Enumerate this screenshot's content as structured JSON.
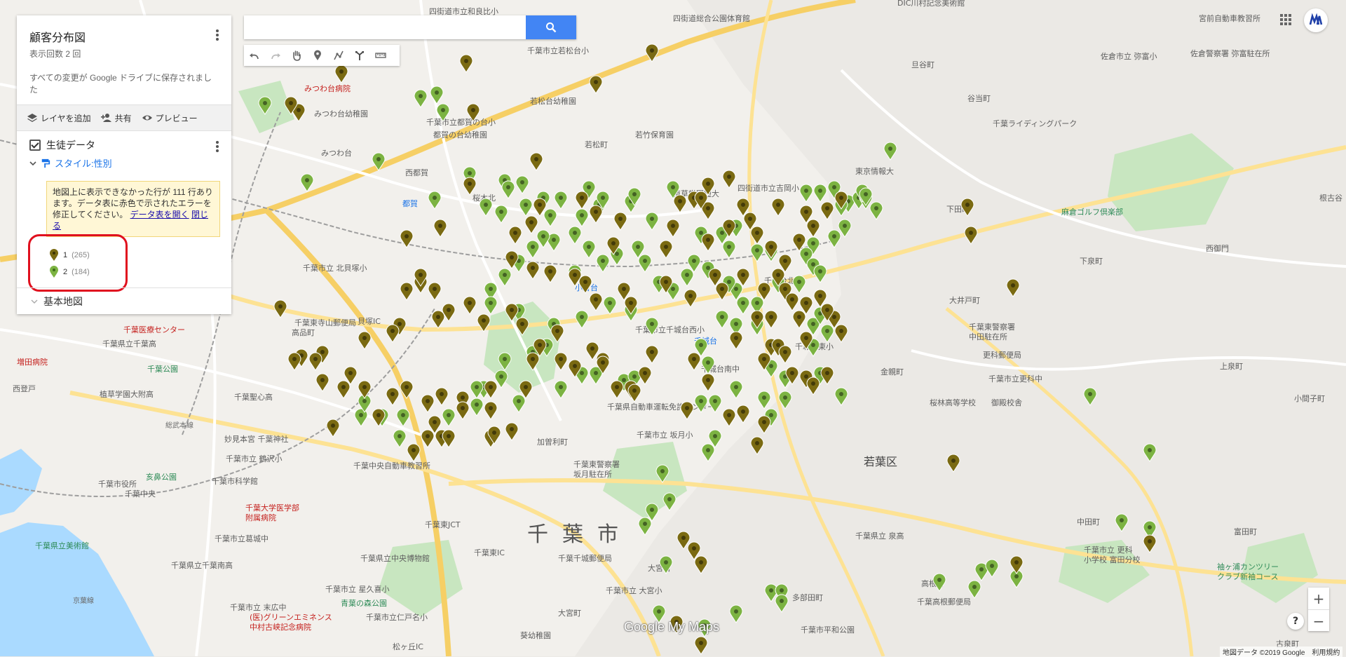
{
  "panel": {
    "title": "顧客分布図",
    "view_count": "表示回数 2 回",
    "save_status": "すべての変更が Google ドライブに保存されました",
    "toolbar": {
      "add_layer": "レイヤを追加",
      "share": "共有",
      "preview": "プレビュー"
    },
    "layer": {
      "name": "生徒データ",
      "style_label": "スタイル:性別",
      "error": {
        "message": "地図上に表示できなかった行が 111 行あります。データ表に赤色で示されたエラーを修正してください。",
        "open_link": "データ表を開く",
        "close_link": "閉じる"
      },
      "legend": [
        {
          "label": "1",
          "count": "(265)",
          "color": "#7a6a12"
        },
        {
          "label": "2",
          "count": "(184)",
          "color": "#7cb342"
        }
      ]
    },
    "base_map_label": "基本地図"
  },
  "search": {
    "placeholder": ""
  },
  "zoom": {
    "in": "+",
    "out": "−"
  },
  "help": "?",
  "logo": "Google My Maps",
  "attribution": "地図データ ©2019 Google　利用規約",
  "map": {
    "city": "千葉市",
    "ward": "若葉区",
    "labels": [
      "四街道市立和良比小",
      "四街道総合公園体育館",
      "DIC川村記念美術館",
      "宮前自動車教習所",
      "佐倉市立 弥富小",
      "佐倉警察署 弥富駐在所",
      "旦谷町",
      "谷当町",
      "千葉ライディングパーク",
      "千葉市立若松台小",
      "若松台幼稚園",
      "若松町",
      "若竹保育園",
      "みつわ台病院",
      "みつわ台幼稚園",
      "千葉市立都賀の台小",
      "都賀の台幼稚園",
      "西都賀",
      "みつわ台",
      "千葉市立桜木小",
      "都賀",
      "東京情報大",
      "下田町",
      "麻倉ゴルフ倶楽部",
      "根古谷",
      "四街道市立吉岡小",
      "植草学園短大",
      "西御門",
      "下泉町",
      "大井戸町",
      "千葉東警察署 中田駐在所",
      "更科郵便局",
      "千葉市立更科中",
      "千葉市立北貝塚小",
      "千葉東寺山郵便局",
      "高品町",
      "千葉医療センター",
      "千葉県立千葉高",
      "千葉公園",
      "増田病院",
      "西登戸",
      "千葉市立桜木小",
      "桜木",
      "千城台西小",
      "千城台南中",
      "千城台東小",
      "金親町",
      "桜林高等学校",
      "御殿校舎",
      "上泉町",
      "小間子町",
      "加曽利町",
      "千葉東警察署 坂月駐在所",
      "千葉市立坂月小",
      "千葉県自動車運転免許センター",
      "植草学園大附高",
      "千葉聖心高",
      "妙見本宮 千葉神社",
      "千葉市立鶴沢小",
      "千葉市科学館",
      "亥鼻公園",
      "千葉市役所",
      "千葉中央",
      "千葉大学医学部附属病院",
      "千葉中央自動車教習所",
      "千葉東JCT",
      "千葉東IC",
      "千葉県立美術館",
      "千葉県立中央博物館",
      "千葉市立星久喜小",
      "千葉千城郵便局",
      "千葉市立大宮小",
      "多部田町",
      "千葉県立泉高",
      "中田町",
      "千葉市立更科小学校 富田分校",
      "富田町",
      "袖ヶ浦カンツリー クラブ新袖コース",
      "千葉高根郵便局",
      "千葉市平和公園",
      "古泉町",
      "高根町",
      "千葉市立葛城中",
      "千葉県立千葉南高",
      "千葉市立末広中",
      "中村古峡記念病院",
      "青葉の森公園",
      "千葉市立仁戸名小",
      "葵幼稚園",
      "松ヶ丘IC",
      "貝塚IC",
      "京葉線",
      "総武本線",
      "大宮町",
      "千城台",
      "小倉台",
      "千城台北",
      "大宮台",
      "都賀",
      "桜木北",
      "若葉区"
    ]
  }
}
